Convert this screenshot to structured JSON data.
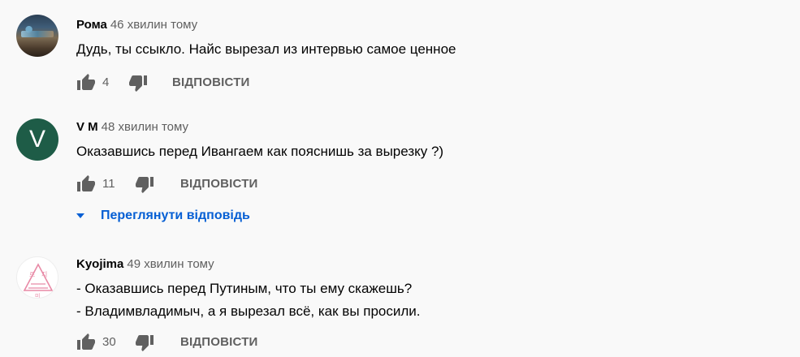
{
  "comments": [
    {
      "author": "Рома",
      "time": "46 хвилин тому",
      "lines": [
        "Дудь, ты ссыкло. Найс вырезал из интервью самое ценное"
      ],
      "likes": "4",
      "reply_label": "ВІДПОВІСТИ",
      "avatar": "photo"
    },
    {
      "author": "V M",
      "time": "48 хвилин тому",
      "lines": [
        "Оказавшись перед Ивангаем как пояснишь за вырезку ?)"
      ],
      "likes": "11",
      "reply_label": "ВІДПОВІСТИ",
      "avatar_letter": "V",
      "avatar_color": "#1e5c47"
    },
    {
      "author": "Kyojima",
      "time": "49 хвилин тому",
      "lines": [
        "- Оказавшись перед Путиным, что ты ему скажешь?",
        "- Владимвладимыч, а я вырезал всё, как вы просили."
      ],
      "likes": "30",
      "reply_label": "ВІДПОВІСТИ",
      "avatar": "logo",
      "avatar_logo_text": [
        "로",
        "지",
        "미"
      ]
    }
  ],
  "view_replies_label": "Переглянути відповідь",
  "colors": {
    "background": "#f9f9f9",
    "link": "#065fd4",
    "secondary": "#606060"
  }
}
